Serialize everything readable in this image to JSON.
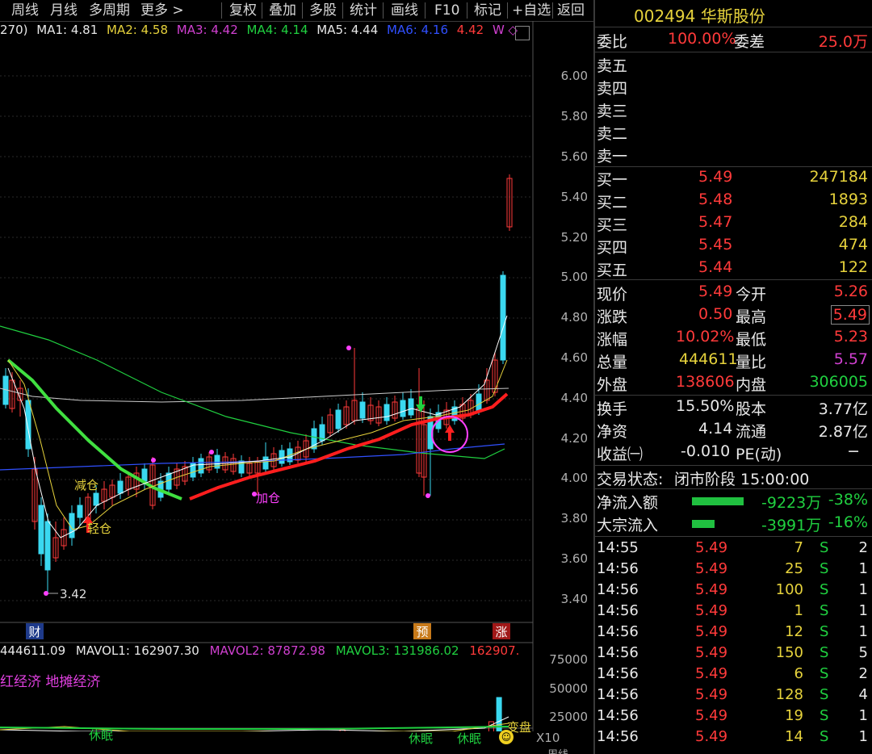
{
  "toolbar": {
    "items": [
      "周线",
      "月线",
      "多周期",
      "更多 >",
      "复权",
      "叠加",
      "多股",
      "统计",
      "画线",
      "F10",
      "标记",
      "+自选",
      "返回"
    ]
  },
  "ma": {
    "prefix": "270)",
    "ma1": "MA1: 4.81",
    "ma2": "MA2: 4.58",
    "ma3": "MA3: 4.42",
    "ma4": "MA4: 4.14",
    "ma5": "MA5: 4.44",
    "ma6": "MA6: 4.16",
    "extra": "4.42",
    "w": "W ◇"
  },
  "colors": {
    "up": "#ff3a3a",
    "down": "#3ad8f0",
    "ma1": "#ffffff",
    "ma2": "#e6d23c",
    "ma3": "#e040e0",
    "ma4": "#20d040",
    "ma6": "#3050ff"
  },
  "price_axis": [
    "6.00",
    "5.80",
    "5.60",
    "5.40",
    "5.20",
    "5.00",
    "4.80",
    "4.60",
    "4.40",
    "4.20",
    "4.00",
    "3.80",
    "3.60",
    "3.40"
  ],
  "annotations": {
    "low": "3.42",
    "jiancang": "减仓",
    "qingcang": "轻仓",
    "jiacang": "加仓",
    "cai": "财",
    "yu": "预",
    "zhang": "涨"
  },
  "volume": {
    "head_vol": "444611.09",
    "mavol1": "MAVOL1: 162907.30",
    "mavol2": "MAVOL2: 87872.98",
    "mavol3": "MAVOL3: 131986.02",
    "tail": "162907.",
    "axis": [
      "75000",
      "50000",
      "25000"
    ],
    "x10": "X10",
    "theme": "红经济 地摊经济",
    "sleep1": "休眠",
    "sleep2": "休眠",
    "sleep3": "休眠",
    "bianpan": "变盘",
    "week": "周线"
  },
  "quote": {
    "code_name": "002494 华斯股份",
    "weibi_label": "委比",
    "weibi_value": "100.00%",
    "weicha_label": "委差",
    "weicha_value": "25.0万",
    "sells": [
      "卖五",
      "卖四",
      "卖三",
      "卖二",
      "卖一"
    ],
    "buys": [
      {
        "label": "买一",
        "price": "5.49",
        "vol": "247184"
      },
      {
        "label": "买二",
        "price": "5.48",
        "vol": "1893"
      },
      {
        "label": "买三",
        "price": "5.47",
        "vol": "284"
      },
      {
        "label": "买四",
        "price": "5.45",
        "vol": "474"
      },
      {
        "label": "买五",
        "price": "5.44",
        "vol": "122"
      }
    ],
    "stats": [
      {
        "l1": "现价",
        "v1": "5.49",
        "l2": "今开",
        "v2": "5.26"
      },
      {
        "l1": "涨跌",
        "v1": "0.50",
        "l2": "最高",
        "v2": "5.49"
      },
      {
        "l1": "涨幅",
        "v1": "10.02%",
        "l2": "最低",
        "v2": "5.23"
      },
      {
        "l1": "总量",
        "v1": "444611",
        "l2": "量比",
        "v2": "5.57"
      },
      {
        "l1": "外盘",
        "v1": "138606",
        "l2": "内盘",
        "v2": "306005"
      }
    ],
    "fund": [
      {
        "l1": "换手",
        "v1": "15.50%",
        "l2": "股本",
        "v2": "3.77亿"
      },
      {
        "l1": "净资",
        "v1": "4.14",
        "l2": "流通",
        "v2": "2.87亿"
      },
      {
        "l1": "收益㈠",
        "v1": "-0.010",
        "l2": "PE(动)",
        "v2": "−"
      }
    ],
    "status_label": "交易状态:",
    "status_value": "闭市阶段 15:00:00",
    "netflow_label": "净流入额",
    "netflow_value": "-9223万",
    "netflow_pct": "-38%",
    "blockflow_label": "大宗流入",
    "blockflow_value": "-3991万",
    "blockflow_pct": "-16%",
    "ticks": [
      {
        "t": "14:55",
        "p": "5.49",
        "v": "7",
        "s": "S",
        "n": "2"
      },
      {
        "t": "14:56",
        "p": "5.49",
        "v": "25",
        "s": "S",
        "n": "1"
      },
      {
        "t": "14:56",
        "p": "5.49",
        "v": "100",
        "s": "S",
        "n": "1"
      },
      {
        "t": "14:56",
        "p": "5.49",
        "v": "1",
        "s": "S",
        "n": "1"
      },
      {
        "t": "14:56",
        "p": "5.49",
        "v": "12",
        "s": "S",
        "n": "1"
      },
      {
        "t": "14:56",
        "p": "5.49",
        "v": "150",
        "s": "S",
        "n": "5"
      },
      {
        "t": "14:56",
        "p": "5.49",
        "v": "6",
        "s": "S",
        "n": "2"
      },
      {
        "t": "14:56",
        "p": "5.49",
        "v": "128",
        "s": "S",
        "n": "4"
      },
      {
        "t": "14:56",
        "p": "5.49",
        "v": "19",
        "s": "S",
        "n": "1"
      },
      {
        "t": "14:56",
        "p": "5.49",
        "v": "14",
        "s": "S",
        "n": "1"
      }
    ]
  }
}
